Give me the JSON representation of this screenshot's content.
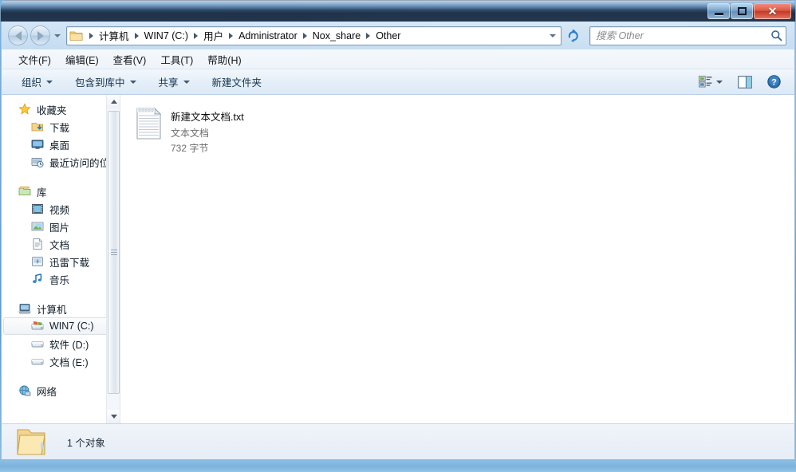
{
  "window": {
    "title": "",
    "controls": {
      "minimize_label": "–",
      "maximize_label": "□",
      "close_label": "✕"
    }
  },
  "navbar": {
    "back_name": "back",
    "forward_name": "forward",
    "history_name": "recent-locations",
    "breadcrumbs": [
      "计算机",
      "WIN7 (C:)",
      "用户",
      "Administrator",
      "Nox_share",
      "Other"
    ],
    "refresh_title": "刷新"
  },
  "search": {
    "placeholder": "搜索 Other",
    "value": ""
  },
  "menubar": {
    "items": [
      {
        "label": "文件(F)"
      },
      {
        "label": "编辑(E)"
      },
      {
        "label": "查看(V)"
      },
      {
        "label": "工具(T)"
      },
      {
        "label": "帮助(H)"
      }
    ]
  },
  "commandbar": {
    "buttons": [
      {
        "label": "组织",
        "has_caret": true
      },
      {
        "label": "包含到库中",
        "has_caret": true
      },
      {
        "label": "共享",
        "has_caret": true
      },
      {
        "label": "新建文件夹",
        "has_caret": false
      }
    ],
    "right_buttons": [
      {
        "name": "change-view",
        "has_caret": true
      },
      {
        "name": "preview-pane",
        "has_caret": false
      },
      {
        "name": "help",
        "has_caret": false
      }
    ]
  },
  "sidebar": {
    "groups": [
      {
        "header": {
          "label": "收藏夹",
          "icon": "star-icon",
          "name": "favorites"
        },
        "items": [
          {
            "label": "下载",
            "icon": "downloads-icon",
            "name": "downloads",
            "selected": false
          },
          {
            "label": "桌面",
            "icon": "desktop-icon",
            "name": "desktop",
            "selected": false
          },
          {
            "label": "最近访问的位置",
            "icon": "recent-places-icon",
            "name": "recent-places",
            "selected": false
          }
        ]
      },
      {
        "header": {
          "label": "库",
          "icon": "library-icon",
          "name": "libraries"
        },
        "items": [
          {
            "label": "视频",
            "icon": "video-icon",
            "name": "videos",
            "selected": false
          },
          {
            "label": "图片",
            "icon": "pictures-icon",
            "name": "pictures",
            "selected": false
          },
          {
            "label": "文档",
            "icon": "documents-icon",
            "name": "documents",
            "selected": false
          },
          {
            "label": "迅雷下载",
            "icon": "thunder-download-icon",
            "name": "thunder-download",
            "selected": false
          },
          {
            "label": "音乐",
            "icon": "music-icon",
            "name": "music",
            "selected": false
          }
        ]
      },
      {
        "header": {
          "label": "计算机",
          "icon": "computer-icon",
          "name": "computer"
        },
        "items": [
          {
            "label": "WIN7 (C:)",
            "icon": "system-drive-icon",
            "name": "drive-c",
            "selected": true
          },
          {
            "label": "软件 (D:)",
            "icon": "drive-icon",
            "name": "drive-d",
            "selected": false
          },
          {
            "label": "文档 (E:)",
            "icon": "drive-icon",
            "name": "drive-e",
            "selected": false
          }
        ]
      },
      {
        "header": {
          "label": "网络",
          "icon": "network-icon",
          "name": "network"
        },
        "items": []
      }
    ]
  },
  "content": {
    "files": [
      {
        "name": "新建文本文档.txt",
        "type": "文本文档",
        "size": "732 字节",
        "icon": "text-file-icon"
      }
    ]
  },
  "statusbar": {
    "icon": "open-folder-icon",
    "text": "1 个对象"
  },
  "colors": {
    "accent": "#2a5f8f",
    "window_bg": "#ffffff",
    "titlebar_dark": "#1c2c42",
    "close_red": "#c23a23",
    "selection_border": "#dcdfe3"
  }
}
